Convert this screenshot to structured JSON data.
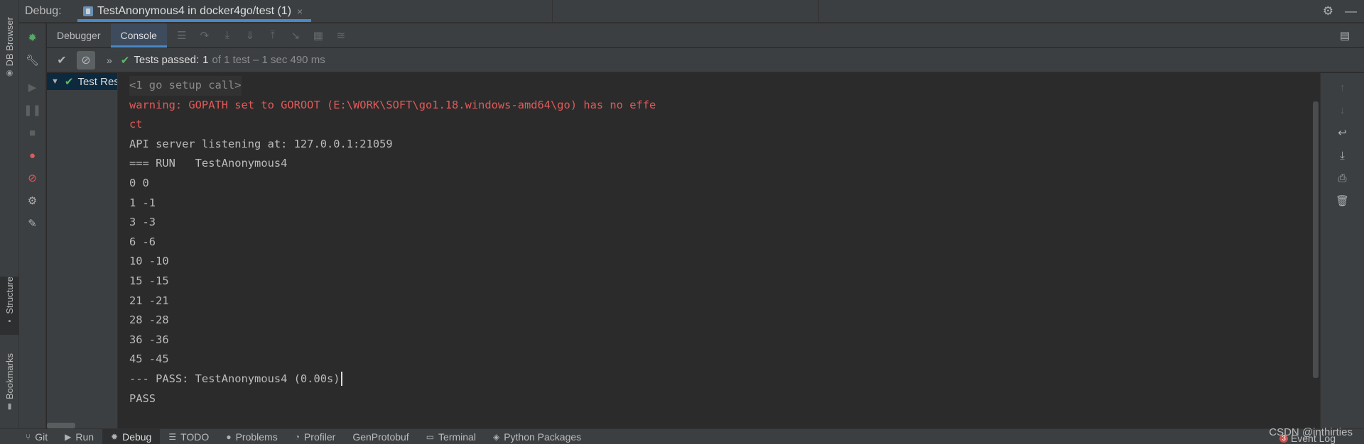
{
  "left_strip": {
    "db_browser": "DB Browser",
    "structure": "Structure",
    "bookmarks": "Bookmarks"
  },
  "header": {
    "label": "Debug:",
    "run_tab": "TestAnonymous4 in docker4go/test (1)",
    "close_glyph": "×"
  },
  "tabs": {
    "debugger": "Debugger",
    "console": "Console"
  },
  "test_status": {
    "passed_label": "Tests passed:",
    "passed_count": "1",
    "detail": "of 1 test – 1 sec 490 ms"
  },
  "test_tree": {
    "root": "Test Results"
  },
  "console": {
    "lines": [
      {
        "text": "<1 go setup call>",
        "kind": "gray"
      },
      {
        "text": "warning: GOPATH set to GOROOT (E:\\WORK\\SOFT\\go1.18.windows-amd64\\go) has no effe",
        "kind": "err"
      },
      {
        "text": "ct",
        "kind": "err"
      },
      {
        "text": "API server listening at: 127.0.0.1:21059",
        "kind": "normal"
      },
      {
        "text": "=== RUN   TestAnonymous4",
        "kind": "normal"
      },
      {
        "text": "0 0",
        "kind": "normal"
      },
      {
        "text": "1 -1",
        "kind": "normal"
      },
      {
        "text": "3 -3",
        "kind": "normal"
      },
      {
        "text": "6 -6",
        "kind": "normal"
      },
      {
        "text": "10 -10",
        "kind": "normal"
      },
      {
        "text": "15 -15",
        "kind": "normal"
      },
      {
        "text": "21 -21",
        "kind": "normal"
      },
      {
        "text": "28 -28",
        "kind": "normal"
      },
      {
        "text": "36 -36",
        "kind": "normal"
      },
      {
        "text": "45 -45",
        "kind": "normal"
      },
      {
        "text": "--- PASS: TestAnonymous4 (0.00s)",
        "kind": "normal"
      },
      {
        "text": "PASS",
        "kind": "normal"
      }
    ]
  },
  "bottom_bar": {
    "git": "Git",
    "run": "Run",
    "debug": "Debug",
    "todo": "TODO",
    "problems": "Problems",
    "profiler": "Profiler",
    "genprotobuf": "GenProtobuf",
    "terminal": "Terminal",
    "python_packages": "Python Packages",
    "event_log": "Event Log",
    "event_log_count": "3",
    "watermark": "CSDN @inthirties"
  },
  "colors": {
    "accent": "#4a88c7",
    "pass_green": "#5fb865",
    "error_red": "#e05a5a",
    "background": "#2b2b2b",
    "panel": "#3c3f41"
  },
  "icons": {
    "debug_bug": "bug-icon",
    "settings": "gear-icon",
    "minimize": "minimize-icon"
  }
}
